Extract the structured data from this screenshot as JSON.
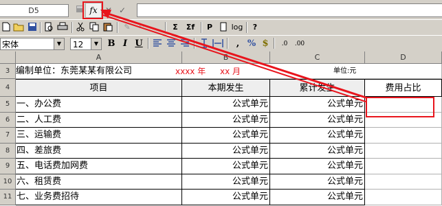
{
  "formula_bar": {
    "name_box": "D5",
    "fx_label": "fx",
    "cancel_symbol": "✕",
    "enter_symbol": "✓",
    "formula_value": ""
  },
  "toolbar1": {
    "sum_label": "Σ",
    "sum_f_label": "Σf",
    "print_label": "P",
    "log_label": "log",
    "help_label": "?"
  },
  "toolbar2": {
    "font_name": "宋体",
    "font_size": "12",
    "bold": "B",
    "italic": "I",
    "underline": "U",
    "comma": ",",
    "percent": "%",
    "currency": "$",
    "inc_decimal": ".0",
    "dec_decimal": ".00"
  },
  "sheet": {
    "columns": [
      "A",
      "B",
      "C",
      "D"
    ],
    "row3": {
      "num": "3",
      "a": "编制单位：东莞某某有限公司",
      "year": "xxxx 年",
      "month": "xx 月",
      "unit": "单位:元"
    },
    "row4": {
      "num": "4",
      "a": "项目",
      "b": "本期发生",
      "c": "累计发生",
      "d": "费用占比"
    },
    "rows": [
      {
        "num": "5",
        "a": "一、办公费",
        "b": "公式单元",
        "c": "公式单元",
        "d": ""
      },
      {
        "num": "6",
        "a": "二、人工费",
        "b": "公式单元",
        "c": "公式单元",
        "d": ""
      },
      {
        "num": "7",
        "a": "三、运输费",
        "b": "公式单元",
        "c": "公式单元",
        "d": ""
      },
      {
        "num": "8",
        "a": "四、差旅费",
        "b": "公式单元",
        "c": "公式单元",
        "d": ""
      },
      {
        "num": "9",
        "a": "五、电话费加网费",
        "b": "公式单元",
        "c": "公式单元",
        "d": ""
      },
      {
        "num": "10",
        "a": "六、租赁费",
        "b": "公式单元",
        "c": "公式单元",
        "d": ""
      },
      {
        "num": "11",
        "a": "七、业务费招待",
        "b": "公式单元",
        "c": "公式单元",
        "d": ""
      }
    ]
  },
  "accent_color": "#e8141c"
}
